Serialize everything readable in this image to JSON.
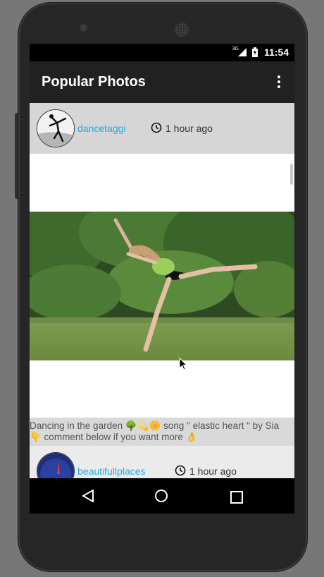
{
  "status_bar": {
    "time": "11:54",
    "network_label": "3G",
    "signal_icon": "signal-icon",
    "battery_icon": "battery-icon"
  },
  "app_bar": {
    "title": "Popular Photos",
    "overflow_icon": "more-vert-icon"
  },
  "posts": [
    {
      "username": "dancetaggi",
      "time": "1 hour ago",
      "caption_line1": "Dancing in the garden 🌳💫🌼 song \" elastic heart \" by Sia",
      "caption_line2": "👇 comment below if you want more 👌"
    },
    {
      "username": "beautifullplaces",
      "time": "1 hour ago"
    }
  ],
  "nav_bar": {
    "back_icon": "back-triangle-icon",
    "home_icon": "home-circle-icon",
    "recents_icon": "recents-square-icon"
  },
  "colors": {
    "app_bar": "#212121",
    "username": "#29a9e0",
    "post_header_bg": "#d6d6d6",
    "caption_bg": "#d9d9d9"
  }
}
